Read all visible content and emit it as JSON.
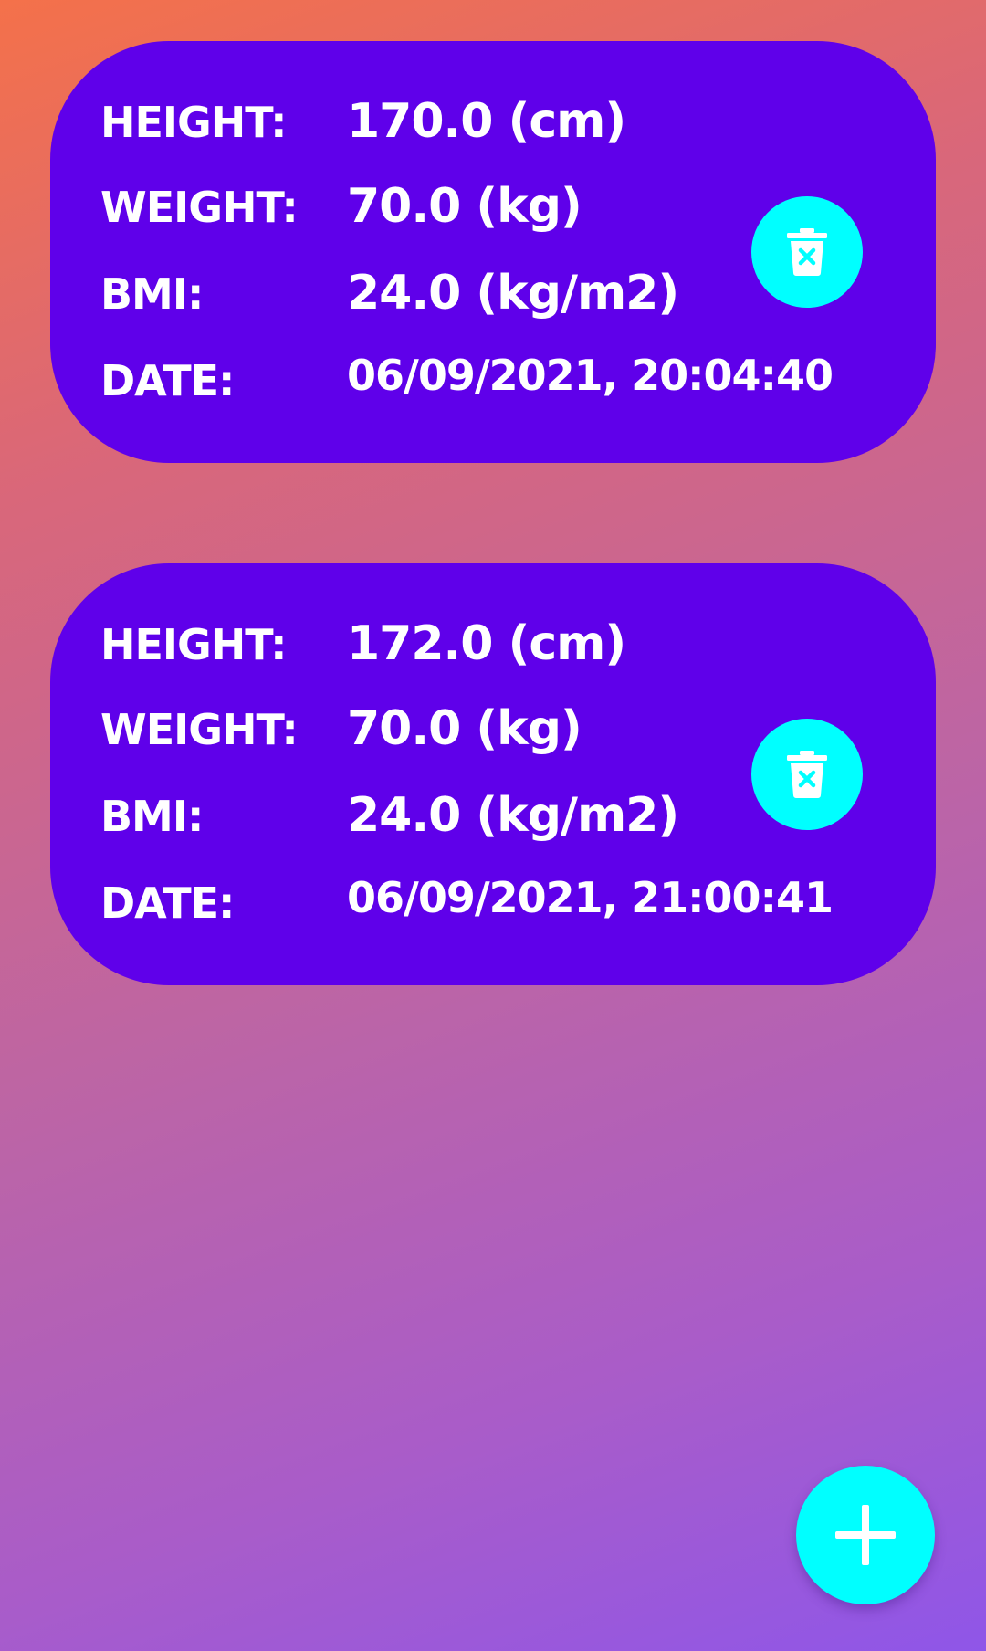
{
  "records": [
    {
      "height_label": "HEIGHT:",
      "height_value": "170.0 (cm)",
      "weight_label": "WEIGHT:",
      "weight_value": "70.0 (kg)",
      "bmi_label": "BMI:",
      "bmi_value": "24.0 (kg/m2)",
      "date_label": "DATE:",
      "date_value": "06/09/2021, 20:04:40"
    },
    {
      "height_label": "HEIGHT:",
      "height_value": "172.0 (cm)",
      "weight_label": "WEIGHT:",
      "weight_value": "70.0 (kg)",
      "bmi_label": "BMI:",
      "bmi_value": "24.0 (kg/m2)",
      "date_label": "DATE:",
      "date_value": "06/09/2021, 21:00:41"
    }
  ],
  "icons": {
    "delete": "trash-icon",
    "add": "plus-icon"
  },
  "colors": {
    "card": "#5f00ea",
    "accent": "#00ffff",
    "text": "#ffffff",
    "gradient_start": "#f4714a",
    "gradient_end": "#8f56e8"
  }
}
